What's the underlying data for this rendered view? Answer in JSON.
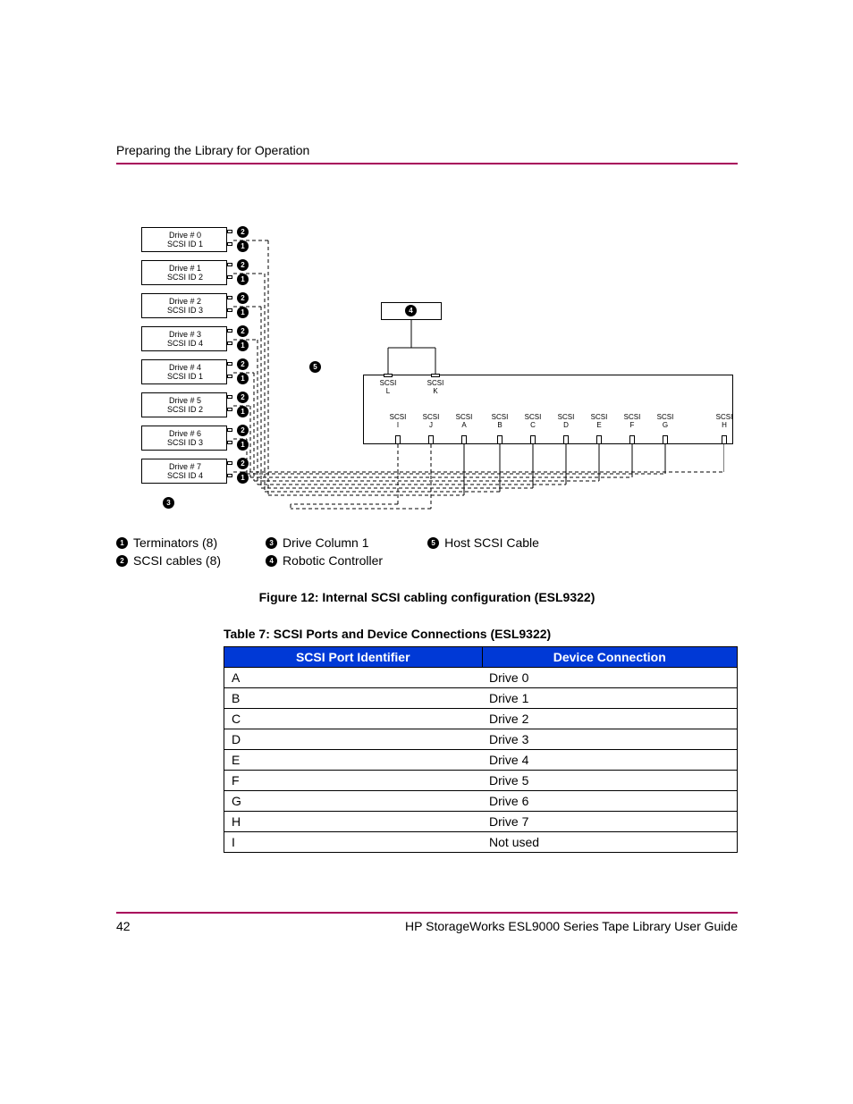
{
  "header": {
    "section_title": "Preparing the Library for Operation"
  },
  "diagram": {
    "drives": [
      {
        "line1": "Drive # 0",
        "line2": "SCSI ID 1"
      },
      {
        "line1": "Drive # 1",
        "line2": "SCSI ID 2"
      },
      {
        "line1": "Drive # 2",
        "line2": "SCSI ID 3"
      },
      {
        "line1": "Drive # 3",
        "line2": "SCSI ID 4"
      },
      {
        "line1": "Drive # 4",
        "line2": "SCSI ID 1"
      },
      {
        "line1": "Drive # 5",
        "line2": "SCSI ID 2"
      },
      {
        "line1": "Drive # 6",
        "line2": "SCSI ID 3"
      },
      {
        "line1": "Drive # 7",
        "line2": "SCSI ID 4"
      }
    ],
    "badges": {
      "b1": "1",
      "b2": "2",
      "b3": "3",
      "b4": "4",
      "b5": "5"
    },
    "scsi_top": [
      {
        "label": "SCSI",
        "sub": "L"
      },
      {
        "label": "SCSI",
        "sub": "K"
      }
    ],
    "scsi_bottom": [
      {
        "label": "SCSI",
        "sub": "I"
      },
      {
        "label": "SCSI",
        "sub": "J"
      },
      {
        "label": "SCSI",
        "sub": "A"
      },
      {
        "label": "SCSI",
        "sub": "B"
      },
      {
        "label": "SCSI",
        "sub": "C"
      },
      {
        "label": "SCSI",
        "sub": "D"
      },
      {
        "label": "SCSI",
        "sub": "E"
      },
      {
        "label": "SCSI",
        "sub": "F"
      },
      {
        "label": "SCSI",
        "sub": "G"
      },
      {
        "label": "SCSI",
        "sub": "H"
      }
    ]
  },
  "legend": {
    "items": [
      {
        "num": "1",
        "text": "Terminators (8)"
      },
      {
        "num": "2",
        "text": "SCSI cables (8)"
      },
      {
        "num": "3",
        "text": "Drive Column 1"
      },
      {
        "num": "4",
        "text": "Robotic Controller"
      },
      {
        "num": "5",
        "text": "Host SCSI Cable"
      }
    ]
  },
  "captions": {
    "figure": "Figure 12:  Internal SCSI cabling configuration (ESL9322)",
    "table": "Table 7:  SCSI Ports and Device Connections (ESL9322)"
  },
  "table": {
    "headers": {
      "col1": "SCSI Port Identifier",
      "col2": "Device Connection"
    },
    "rows": [
      {
        "port": "A",
        "device": "Drive 0"
      },
      {
        "port": "B",
        "device": "Drive 1"
      },
      {
        "port": "C",
        "device": "Drive 2"
      },
      {
        "port": "D",
        "device": "Drive 3"
      },
      {
        "port": "E",
        "device": "Drive 4"
      },
      {
        "port": "F",
        "device": "Drive 5"
      },
      {
        "port": "G",
        "device": "Drive 6"
      },
      {
        "port": "H",
        "device": "Drive 7"
      },
      {
        "port": "I",
        "device": "Not used"
      }
    ]
  },
  "footer": {
    "page_number": "42",
    "doc_title": "HP StorageWorks ESL9000 Series Tape Library User Guide"
  }
}
